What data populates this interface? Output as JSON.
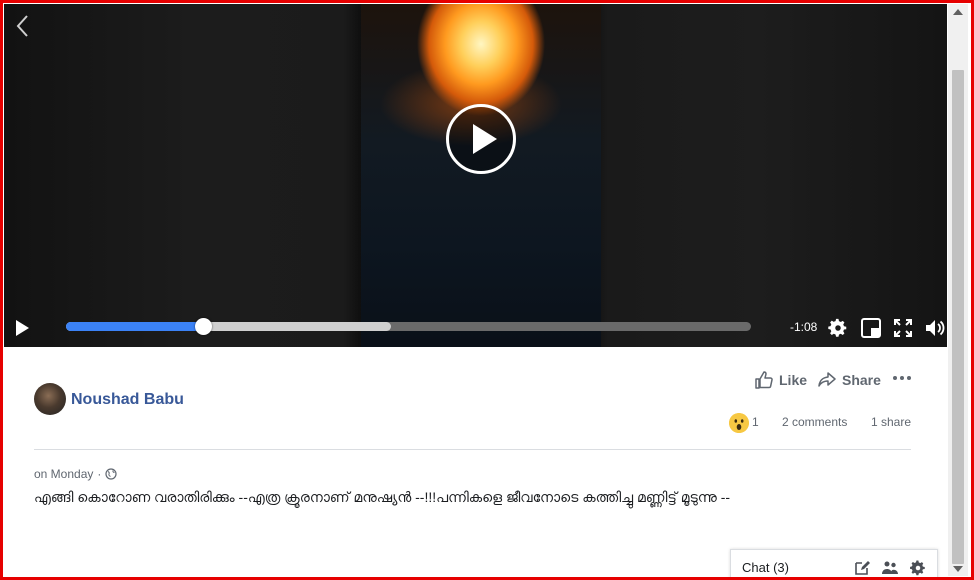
{
  "video": {
    "time_remaining": "-1:08",
    "progress_played": 0.2,
    "progress_buffered": 0.475,
    "icons": {
      "back": "chevron-left-icon",
      "big_play": "play-circle-icon",
      "play": "play-icon",
      "settings": "gear-icon",
      "mini_player": "picture-in-picture-icon",
      "fullscreen": "fullscreen-icon",
      "volume": "volume-icon"
    }
  },
  "post": {
    "author": "Noushad Babu",
    "timestamp": "on Monday",
    "privacy_icon": "globe-icon",
    "text": "എങ്ങി കൊറോണ വരാതിരിക്കും --എത്ര ക്രൂരനാണ് മനുഷ്യൻ --!!!പന്നികളെ ജീവനോടെ കത്തിച്ചു മണ്ണിട്ട് മൂടുന്നു --",
    "actions": {
      "like": "Like",
      "share": "Share"
    },
    "stats": {
      "reaction_count": "1",
      "comments": "2 comments",
      "shares": "1 share"
    },
    "reaction_emoji": "wow-emoji"
  },
  "chat": {
    "label": "Chat (3)",
    "icons": [
      "compose-icon",
      "group-icon",
      "gear-icon"
    ]
  },
  "colors": {
    "frame_border": "#e60000",
    "author_link": "#385898",
    "progress_played": "#3b82f6"
  }
}
